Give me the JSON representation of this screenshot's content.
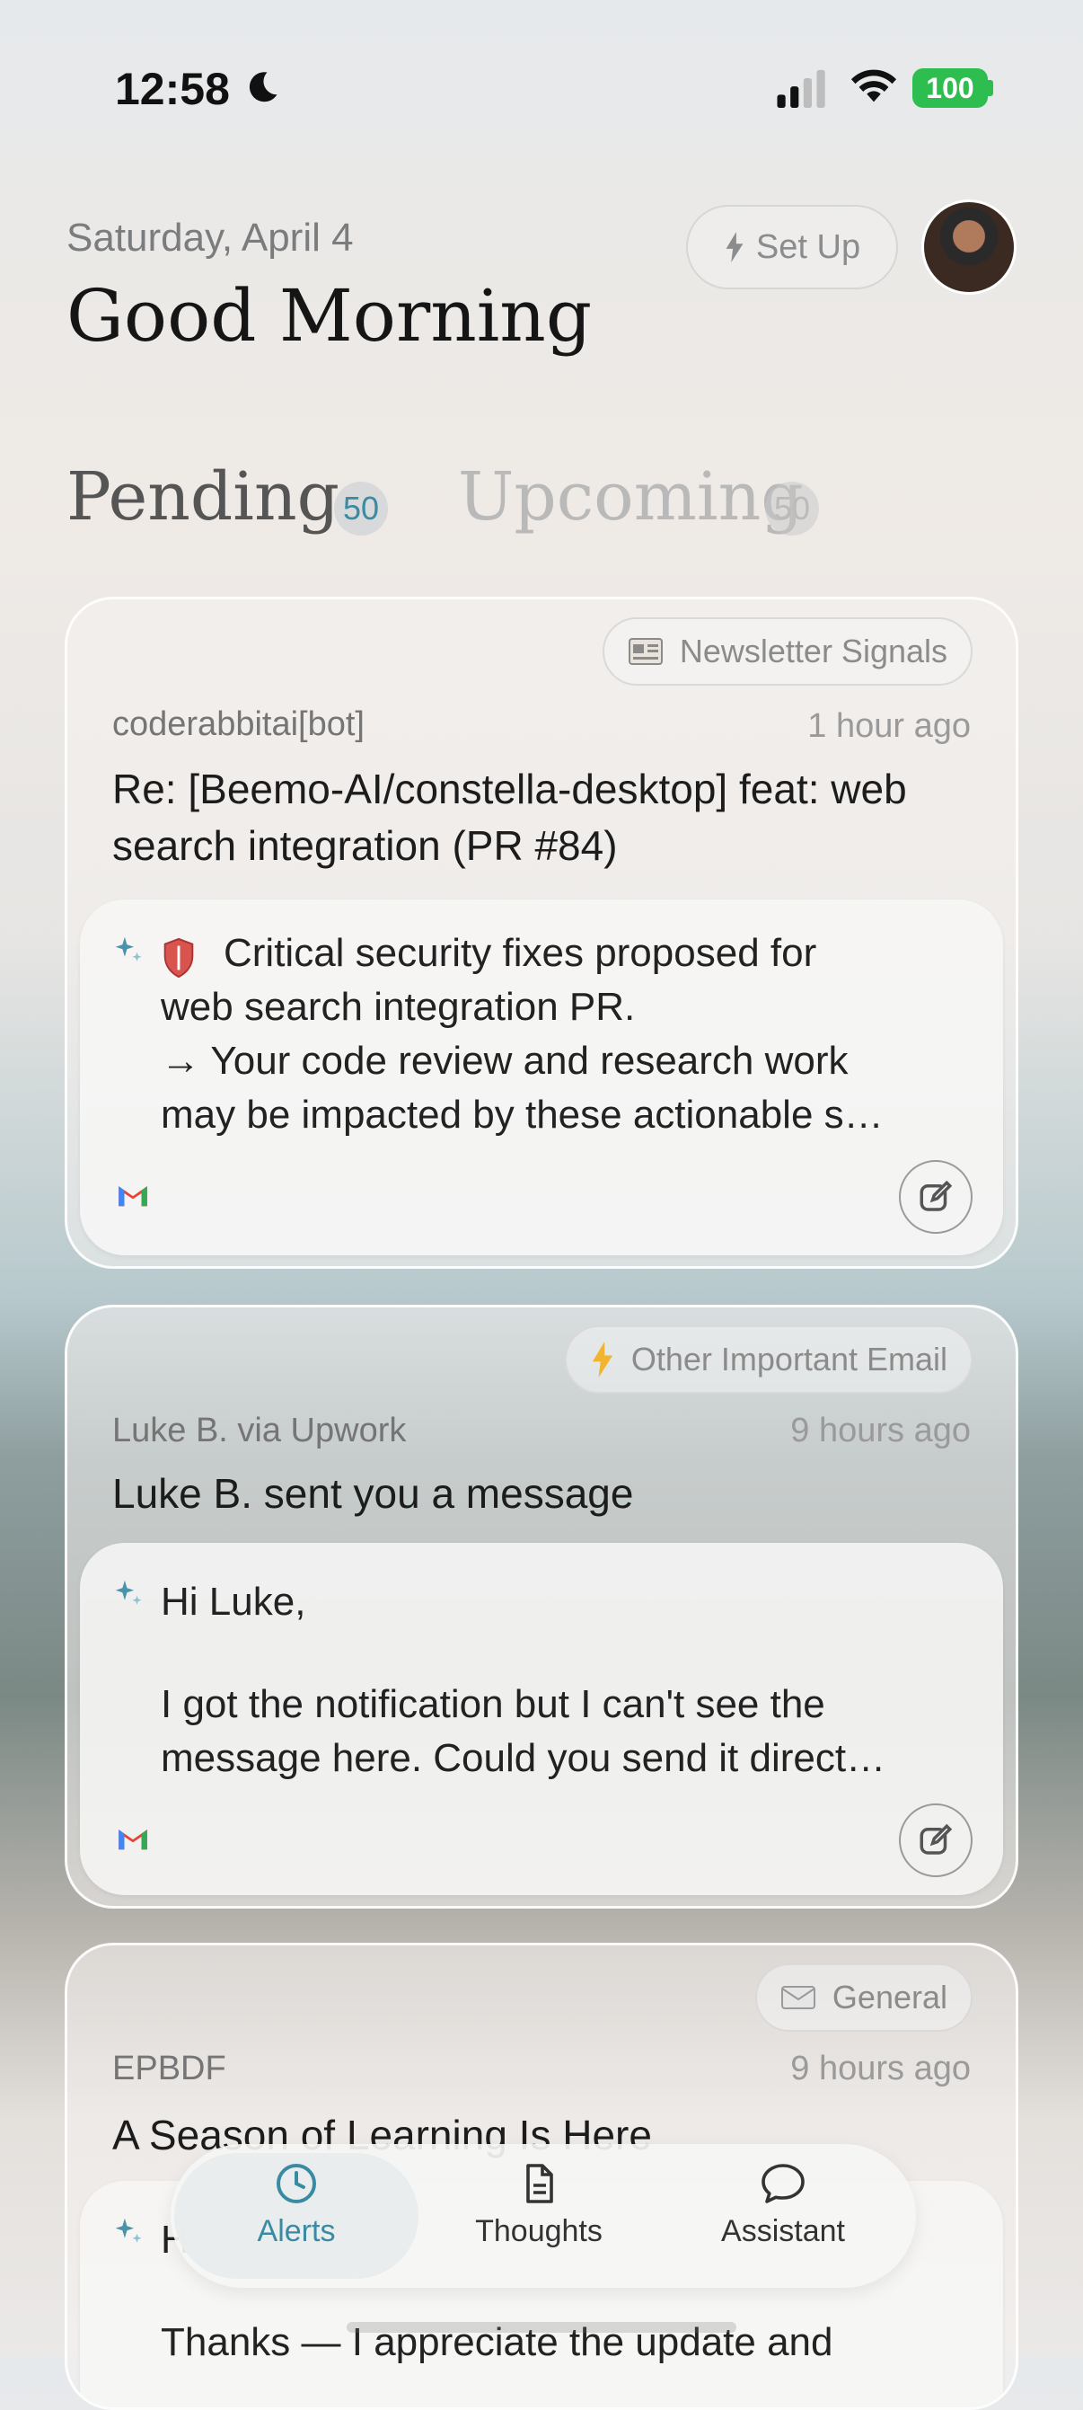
{
  "status": {
    "time": "12:58",
    "battery": "100"
  },
  "header": {
    "date": "Saturday, April 4",
    "greeting": "Good Morning",
    "setup_label": "Set Up"
  },
  "tabs": [
    {
      "label": "Pending",
      "count": "50",
      "active": true
    },
    {
      "label": "Upcoming",
      "count": "50",
      "active": false
    }
  ],
  "cards": [
    {
      "tag": "Newsletter Signals",
      "tag_icon": "newspaper-icon",
      "sender": "coderabbitai[bot]",
      "time": "1 hour ago",
      "subject": "Re: [Beemo-AI/constella-desktop] feat: web search integration (PR #84)",
      "summary_lines": [
        "Critical security fixes proposed for",
        "web search integration PR.",
        "→ Your code review and research work",
        "may be impacted by these actionable s…"
      ]
    },
    {
      "tag": "Other Important Email",
      "tag_icon": "lightning-icon",
      "sender": "Luke B. via Upwork",
      "time": "9 hours ago",
      "subject": "Luke B. sent you a message",
      "summary_lines": [
        "Hi Luke,",
        "",
        "I got the notification but I can't see the",
        "message here. Could you send it direct…"
      ]
    },
    {
      "tag": "General",
      "tag_icon": "envelope-icon",
      "sender": "EPBDF",
      "time": "9 hours ago",
      "subject": "A Season of Learning Is Here",
      "summary_lines": [
        "H",
        "",
        "Thanks — I appreciate the update and"
      ]
    }
  ],
  "nav": [
    {
      "label": "Alerts",
      "icon": "clock-icon",
      "active": true
    },
    {
      "label": "Thoughts",
      "icon": "document-icon",
      "active": false
    },
    {
      "label": "Assistant",
      "icon": "chat-bubble-icon",
      "active": false
    }
  ],
  "colors": {
    "accent": "#3a8aa3",
    "battery": "#2ebe4f"
  }
}
